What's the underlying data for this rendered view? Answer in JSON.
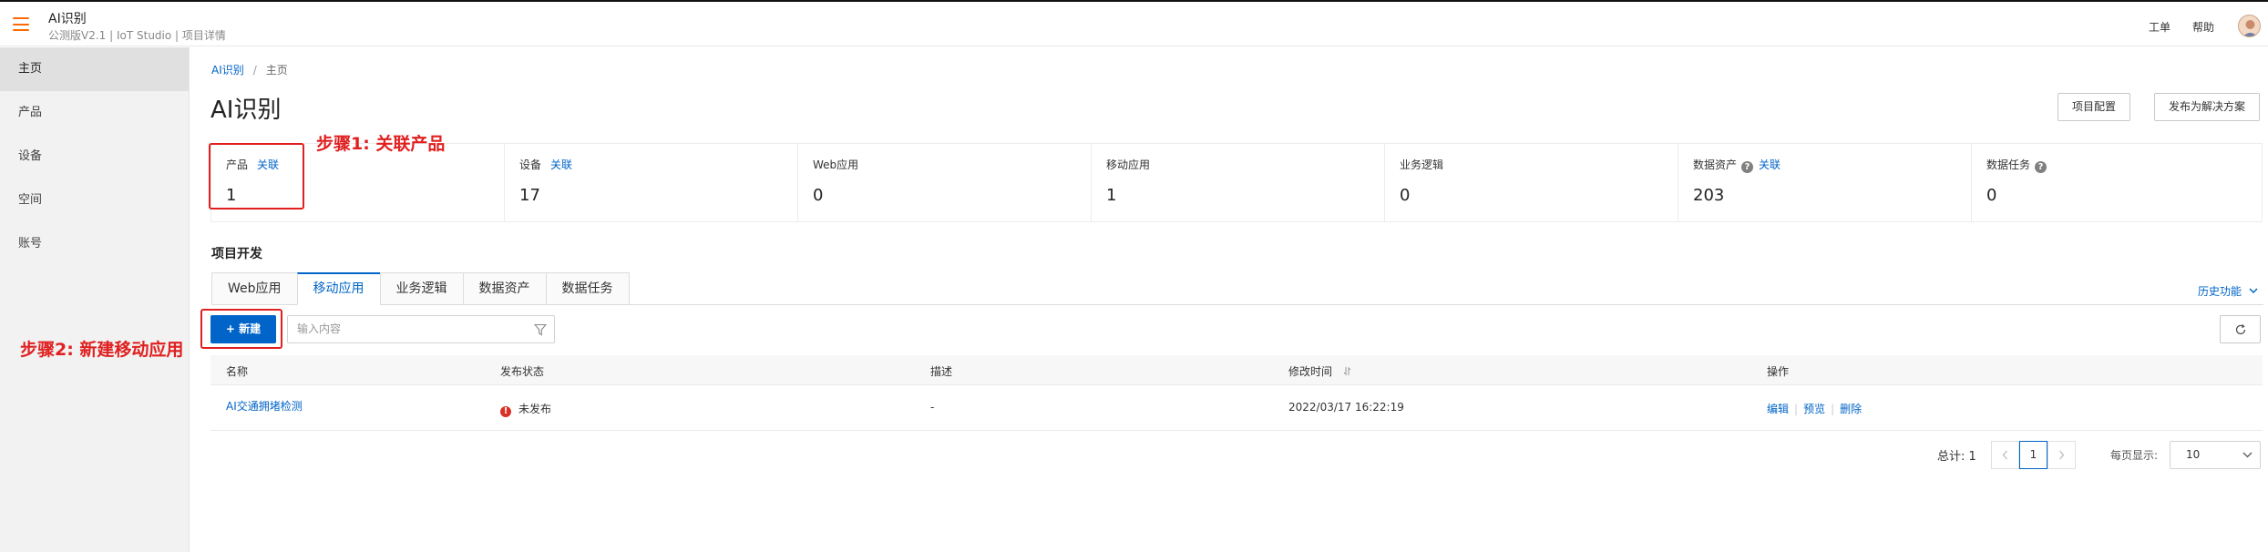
{
  "header": {
    "app_title": "AI识别",
    "app_subtitle": "公测版V2.1 | IoT Studio | 项目详情",
    "links": [
      "工单",
      "帮助"
    ]
  },
  "sidebar": {
    "items": [
      {
        "label": "主页",
        "active": true
      },
      {
        "label": "产品",
        "active": false
      },
      {
        "label": "设备",
        "active": false
      },
      {
        "label": "空间",
        "active": false
      },
      {
        "label": "账号",
        "active": false
      }
    ]
  },
  "breadcrumb": {
    "root": "AI识别",
    "separator": "/",
    "current": "主页"
  },
  "page": {
    "title": "AI识别",
    "project_config_label": "项目配置",
    "publish_label": "发布为解决方案"
  },
  "stats": [
    {
      "label": "产品",
      "link": "关联",
      "value": "1"
    },
    {
      "label": "设备",
      "link": "关联",
      "value": "17"
    },
    {
      "label": "Web应用",
      "value": "0"
    },
    {
      "label": "移动应用",
      "value": "1"
    },
    {
      "label": "业务逻辑",
      "value": "0"
    },
    {
      "label": "数据资产",
      "link": "关联",
      "help": "?",
      "value": "203"
    },
    {
      "label": "数据任务",
      "help": "?",
      "value": "0"
    }
  ],
  "annotations": {
    "step1": "步骤1: 关联产品",
    "step2": "步骤2: 新建移动应用"
  },
  "dev": {
    "section_title": "项目开发",
    "tabs": [
      {
        "label": "Web应用",
        "active": false
      },
      {
        "label": "移动应用",
        "active": true
      },
      {
        "label": "业务逻辑",
        "active": false
      },
      {
        "label": "数据资产",
        "active": false
      },
      {
        "label": "数据任务",
        "active": false
      }
    ],
    "history_label": "历史功能",
    "new_button": "+ 新建",
    "search_placeholder": "输入内容"
  },
  "table": {
    "columns": [
      "名称",
      "发布状态",
      "描述",
      "修改时间",
      "操作"
    ],
    "rows": [
      {
        "name": "AI交通拥堵检测",
        "status_icon": "!",
        "status": "未发布",
        "description": "-",
        "modified": "2022/03/17 16:22:19",
        "actions": [
          "编辑",
          "预览",
          "删除"
        ]
      }
    ]
  },
  "pagination": {
    "total_label": "总计: 1",
    "current_page": "1",
    "page_size_label": "每页显示:",
    "page_size": "10"
  },
  "colors": {
    "accent": "#0064c8",
    "brand": "#ff6a00",
    "annotation": "#e02020"
  }
}
